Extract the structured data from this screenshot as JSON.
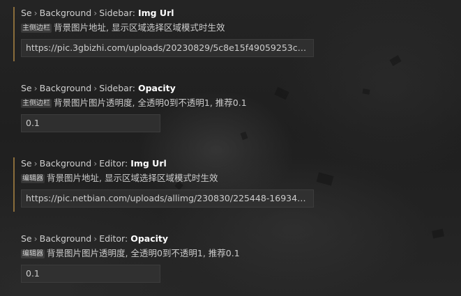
{
  "settings": [
    {
      "prefix": "Se",
      "group": "Background",
      "scope": "Sidebar:",
      "key": "Img Url",
      "code_tag": "主侧边栏",
      "description": "背景图片地址, 显示区域选择区域模式时生效",
      "value": "https://pic.3gbizhi.com/uploads/20230829/5c8e15f49059253cf55ebb..."
    },
    {
      "prefix": "Se",
      "group": "Background",
      "scope": "Sidebar:",
      "key": "Opacity",
      "code_tag": "主侧边栏",
      "description": "背景图片图片透明度, 全透明0到不透明1, 推荐0.1",
      "value": "0.1"
    },
    {
      "prefix": "Se",
      "group": "Background",
      "scope": "Editor:",
      "key": "Img Url",
      "code_tag": "编辑器",
      "description": "背景图片地址, 显示区域选择区域模式时生效",
      "value": "https://pic.netbian.com/uploads/allimg/230830/225448-1693407288..."
    },
    {
      "prefix": "Se",
      "group": "Background",
      "scope": "Editor:",
      "key": "Opacity",
      "code_tag": "编辑器",
      "description": "背景图片图片透明度, 全透明0到不透明1, 推荐0.1",
      "value": "0.1"
    }
  ],
  "colors": {
    "modified_indicator": "#8a6d3b",
    "input_background": "#313131",
    "background": "#1f1f1f"
  }
}
